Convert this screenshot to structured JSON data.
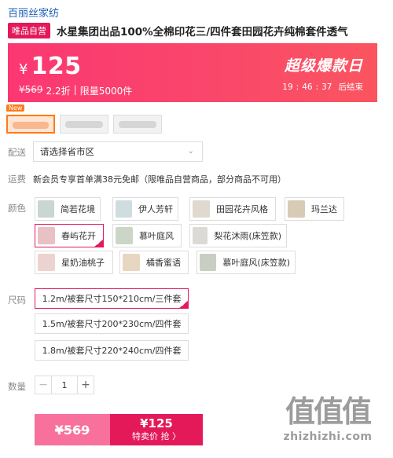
{
  "store": {
    "name": "百丽丝家纺"
  },
  "product": {
    "self_badge": "唯品自营",
    "title": "水星集团出品100%全棉印花三/四件套田园花卉纯棉套件透气"
  },
  "promo": {
    "currency": "¥",
    "price": "125",
    "orig_price": "¥569",
    "discount": "2.2折",
    "separator": "|",
    "limit": "限量5000件",
    "event_title": "超级爆款日",
    "countdown": {
      "h": "19",
      "sep1": ":",
      "m": "46",
      "sep2": ":",
      "s": "37",
      "end_label": "后结束"
    },
    "colors": {
      "start": "#fb3772",
      "end": "#fb5560"
    }
  },
  "thumb_new_tag": "New",
  "delivery": {
    "label": "配送",
    "placeholder": "请选择省市区",
    "caret": "⌄"
  },
  "shipping": {
    "label": "运费",
    "text": "新会员专享首单满38元免邮（限唯品自营商品，部分商品不可用）"
  },
  "colors": {
    "label": "颜色",
    "options": [
      {
        "name": "简若花境",
        "selected": false,
        "swatch": "#c9d6d2"
      },
      {
        "name": "伊人芳轩",
        "selected": false,
        "swatch": "#cfdde0"
      },
      {
        "name": "田园花卉风格",
        "selected": false,
        "swatch": "#e0d9cf"
      },
      {
        "name": "玛兰达",
        "selected": false,
        "swatch": "#d8cbb6"
      },
      {
        "name": "春屿花开",
        "selected": true,
        "swatch": "#e7c1c4"
      },
      {
        "name": "慕叶庭风",
        "selected": false,
        "swatch": "#ccd6c7"
      },
      {
        "name": "梨花沐雨(床笠款)",
        "selected": false,
        "swatch": "#dcdad6"
      },
      {
        "name": "星奶油桃子",
        "selected": false,
        "swatch": "#ecd3cf"
      },
      {
        "name": "橘香蜜语",
        "selected": false,
        "swatch": "#e7d7c0"
      },
      {
        "name": "慕叶庭风(床笠款)",
        "selected": false,
        "swatch": "#c8cfc2"
      }
    ]
  },
  "sizes": {
    "label": "尺码",
    "options": [
      {
        "name": "1.2m/被套尺寸150*210cm/三件套",
        "selected": true
      },
      {
        "name": "1.5m/被套尺寸200*230cm/四件套",
        "selected": false
      },
      {
        "name": "1.8m/被套尺寸220*240cm/四件套",
        "selected": false
      }
    ]
  },
  "quantity": {
    "label": "数量",
    "value": "1",
    "minus": "−",
    "plus": "+"
  },
  "buy": {
    "orig_price": "¥569",
    "price": "¥125",
    "label": "特卖价 抢 〉"
  },
  "watermark": {
    "mark": "值值值",
    "site": "zhizhizhi.com"
  },
  "check_mark": "✔"
}
